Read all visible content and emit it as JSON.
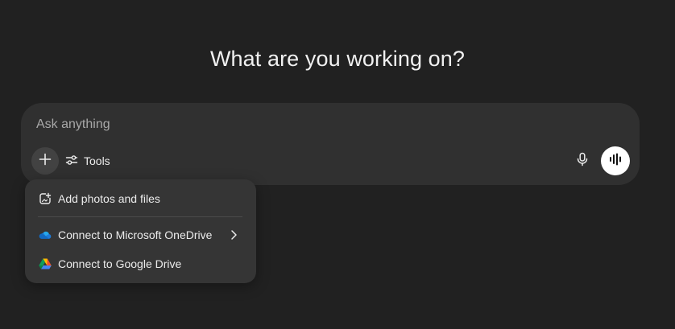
{
  "heading": "What are you working on?",
  "composer": {
    "placeholder": "Ask anything",
    "value": "",
    "tools_label": "Tools"
  },
  "menu": {
    "items": [
      {
        "label": "Add photos and files",
        "icon": "paperclip-add-icon"
      },
      {
        "label": "Connect to Microsoft OneDrive",
        "icon": "onedrive-icon",
        "has_submenu": true
      },
      {
        "label": "Connect to Google Drive",
        "icon": "google-drive-icon"
      }
    ]
  },
  "colors": {
    "background": "#212121",
    "composer": "#303030",
    "menu": "#353535",
    "text": "#ececec",
    "placeholder": "#a8a8a8",
    "voice_button": "#ffffff"
  }
}
